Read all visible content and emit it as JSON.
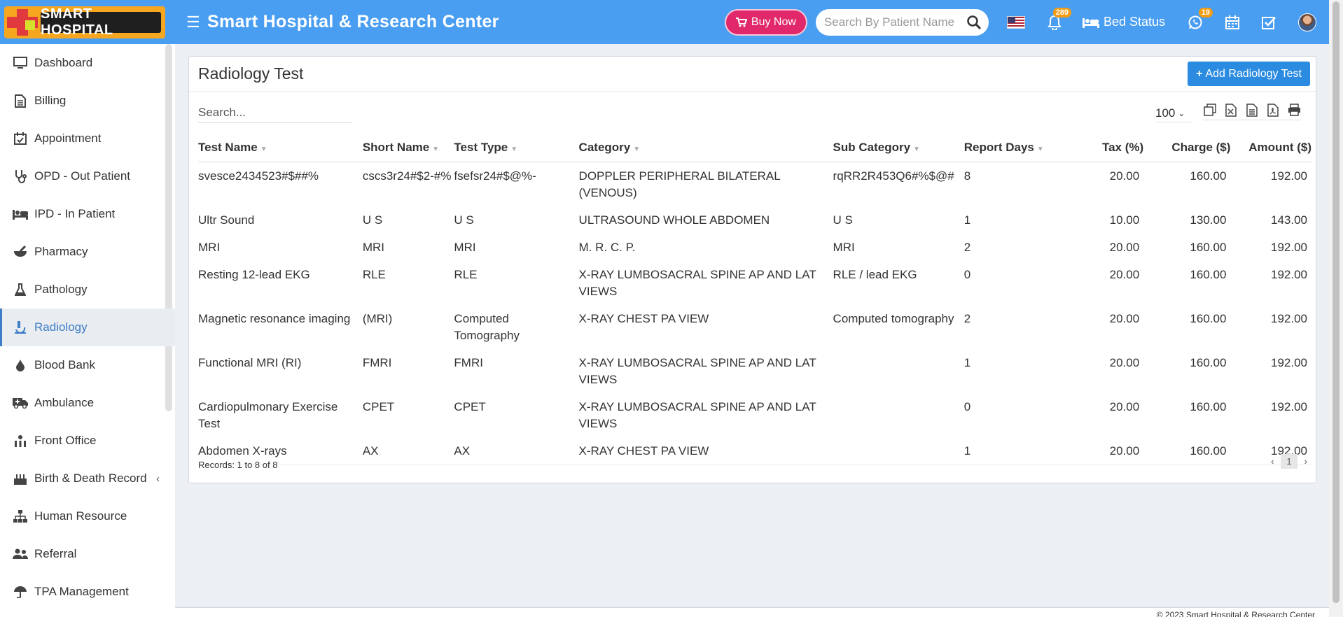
{
  "header": {
    "logo_text": "SMART HOSPITAL",
    "title": "Smart Hospital & Research Center",
    "buy_now": "Buy Now",
    "search_placeholder": "Search By Patient Name",
    "notification_count": "289",
    "bed_status": "Bed Status",
    "whatsapp_count": "19"
  },
  "sidebar": {
    "items": [
      {
        "label": "Dashboard",
        "icon": "monitor-icon"
      },
      {
        "label": "Billing",
        "icon": "document-icon"
      },
      {
        "label": "Appointment",
        "icon": "calendar-check-icon"
      },
      {
        "label": "OPD - Out Patient",
        "icon": "stethoscope-icon"
      },
      {
        "label": "IPD - In Patient",
        "icon": "bed-icon"
      },
      {
        "label": "Pharmacy",
        "icon": "mortar-icon"
      },
      {
        "label": "Pathology",
        "icon": "flask-icon"
      },
      {
        "label": "Radiology",
        "icon": "microscope-icon"
      },
      {
        "label": "Blood Bank",
        "icon": "drop-icon"
      },
      {
        "label": "Ambulance",
        "icon": "ambulance-icon"
      },
      {
        "label": "Front Office",
        "icon": "building-icon"
      },
      {
        "label": "Birth & Death Record",
        "icon": "cake-icon"
      },
      {
        "label": "Human Resource",
        "icon": "sitemap-icon"
      },
      {
        "label": "Referral",
        "icon": "users-icon"
      },
      {
        "label": "TPA Management",
        "icon": "umbrella-icon"
      }
    ],
    "active": "Radiology"
  },
  "page": {
    "title": "Radiology Test",
    "add_button": "Add Radiology Test",
    "search_placeholder": "Search...",
    "page_length": "100",
    "records_text": "Records: 1 to 8 of 8",
    "current_page": "1",
    "footer": "© 2023 Smart Hospital & Research Center"
  },
  "table": {
    "columns": [
      "Test Name",
      "Short Name",
      "Test Type",
      "Category",
      "Sub Category",
      "Report Days",
      "Tax (%)",
      "Charge ($)",
      "Amount ($)"
    ],
    "rows": [
      [
        "svesce2434523#$##%",
        "cscs3r24#$2-#%",
        "fsefsr24#$@%-",
        "DOPPLER PERIPHERAL BILATERAL (VENOUS)",
        "rqRR2R453Q6#%$@#",
        "8",
        "20.00",
        "160.00",
        "192.00"
      ],
      [
        "Ultr Sound",
        "U S",
        "U S",
        "ULTRASOUND WHOLE ABDOMEN",
        "U S",
        "1",
        "10.00",
        "130.00",
        "143.00"
      ],
      [
        "MRI",
        "MRI",
        "MRI",
        "M. R. C. P.",
        "MRI",
        "2",
        "20.00",
        "160.00",
        "192.00"
      ],
      [
        "Resting 12-lead EKG",
        "RLE",
        "RLE",
        "X-RAY LUMBOSACRAL SPINE AP AND LAT VIEWS",
        "RLE / lead EKG",
        "0",
        "20.00",
        "160.00",
        "192.00"
      ],
      [
        "Magnetic resonance imaging",
        "(MRI)",
        "Computed Tomography",
        "X-RAY CHEST PA VIEW",
        "Computed tomography",
        "2",
        "20.00",
        "160.00",
        "192.00"
      ],
      [
        "Functional MRI (RI)",
        "FMRI",
        "FMRI",
        "X-RAY LUMBOSACRAL SPINE AP AND LAT VIEWS",
        "",
        "1",
        "20.00",
        "160.00",
        "192.00"
      ],
      [
        "Cardiopulmonary Exercise Test",
        "CPET",
        "CPET",
        "X-RAY LUMBOSACRAL SPINE AP AND LAT VIEWS",
        "",
        "0",
        "20.00",
        "160.00",
        "192.00"
      ],
      [
        "Abdomen X-rays",
        "AX",
        "AX",
        "X-RAY CHEST PA VIEW",
        "",
        "1",
        "20.00",
        "160.00",
        "192.00"
      ]
    ]
  },
  "colors": {
    "header_bg": "#4a9ef1",
    "buy_now_bg": "#e0286b",
    "primary_button": "#2a8be0",
    "badge": "#f39c12",
    "active_text": "#3b7dc6"
  }
}
